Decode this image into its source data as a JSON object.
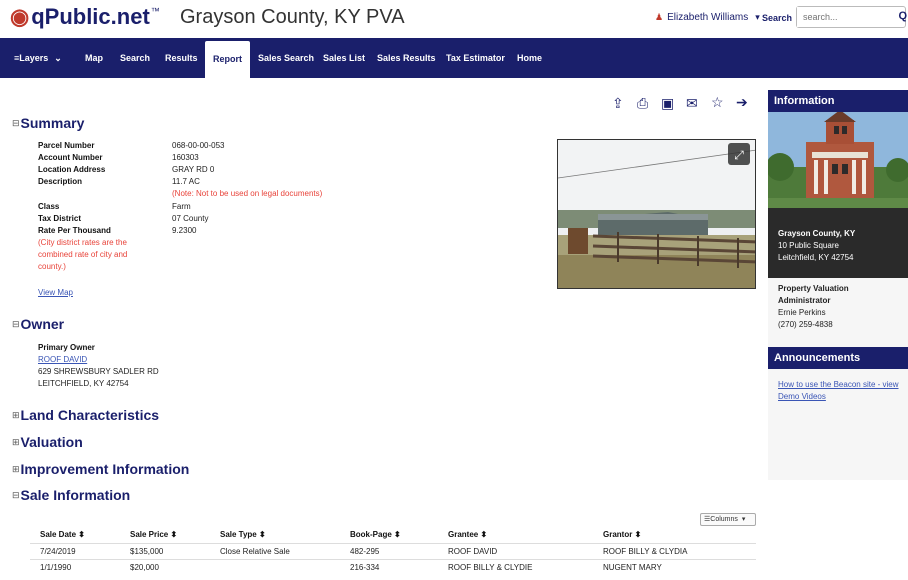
{
  "header": {
    "logo_text": "qPublic.net",
    "logo_tm": "™",
    "county_title": "Grayson County, KY PVA",
    "user_name": "Elizabeth Williams",
    "search_label": "Search",
    "search_placeholder": "search..."
  },
  "nav": {
    "items": [
      "Layers",
      "Map",
      "Search",
      "Results",
      "Report",
      "Sales Search",
      "Sales List",
      "Sales Results",
      "Tax Estimator",
      "Home"
    ],
    "active": "Report"
  },
  "summary": {
    "title": "Summary",
    "labels": {
      "parcel": "Parcel Number",
      "account": "Account Number",
      "location": "Location Address",
      "description": "Description",
      "class": "Class",
      "tax_district": "Tax District",
      "rate": "Rate Per Thousand"
    },
    "values": {
      "parcel": "068-00-00-053",
      "account": "160303",
      "location": "GRAY RD 0",
      "description": "11.7 AC",
      "class": "Farm",
      "tax_district": "07 County",
      "rate": "9.2300"
    },
    "legal_note": "(Note: Not to be used on legal documents)",
    "city_note": [
      "(City district rates are the",
      "combined rate of city and",
      "county.)"
    ],
    "view_map": "View Map"
  },
  "owner": {
    "title": "Owner",
    "primary_label": "Primary Owner",
    "name": "ROOF DAVID",
    "address1": "629 SHREWSBURY SADLER RD",
    "address2": "LEITCHFIELD, KY 42754"
  },
  "collapsed_sections": [
    "Land Characteristics",
    "Valuation",
    "Improvement Information"
  ],
  "sales": {
    "title": "Sale Information",
    "columns_button": "Columns",
    "headers": [
      "Sale Date",
      "Sale Price",
      "Sale Type",
      "Book-Page",
      "Grantee",
      "Grantor"
    ],
    "rows": [
      [
        "7/24/2019",
        "$135,000",
        "Close Relative Sale",
        "482-295",
        "ROOF DAVID",
        "ROOF BILLY & CLYDIA"
      ],
      [
        "1/1/1990",
        "$20,000",
        "",
        "216-334",
        "ROOF BILLY & CLYDIE",
        "NUGENT MARY"
      ]
    ]
  },
  "sidebar": {
    "info_title": "Information",
    "county_name": "Grayson County, KY",
    "address1": "10 Public Square",
    "address2": "Leitchfield, KY 42754",
    "pva_title1": "Property Valuation",
    "pva_title2": "Administrator",
    "pva_name": "Ernie Perkins",
    "pva_phone": "(270) 259-4838",
    "announce_title": "Announcements",
    "announce_link1": "How to use the Beacon site - view",
    "announce_link2": "Demo Videos"
  },
  "colors": {
    "navy": "#1a1f6b",
    "accent_red": "#e8433a",
    "link": "#3a55b5"
  }
}
